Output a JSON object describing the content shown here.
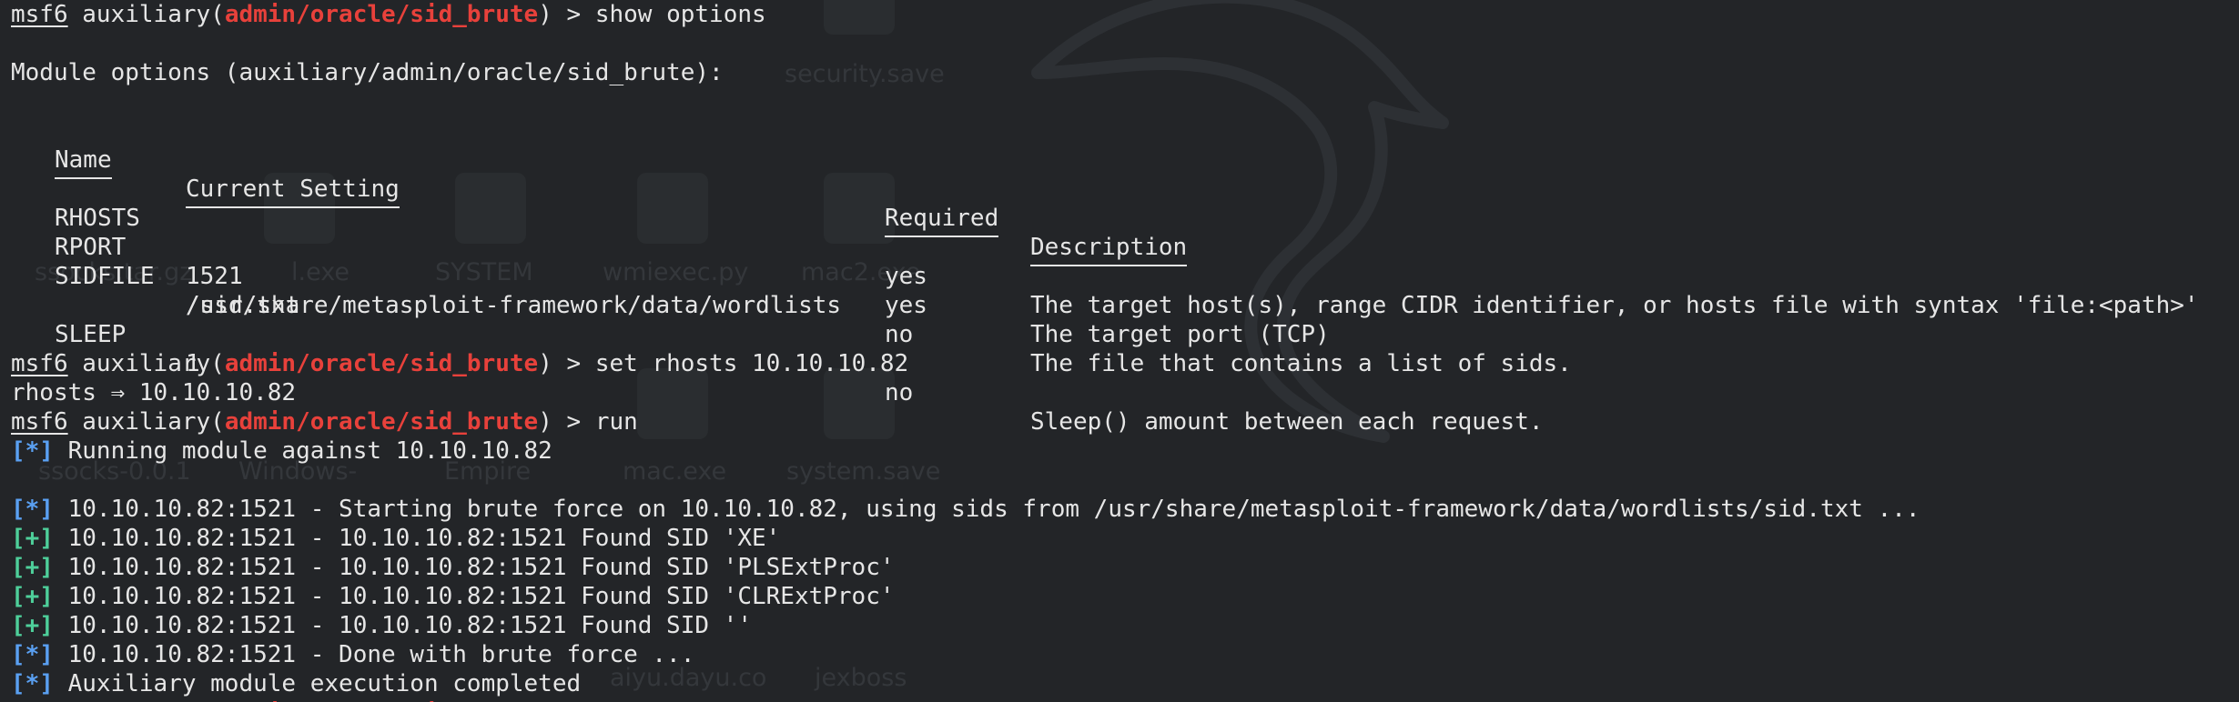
{
  "prompt": {
    "user": "msf6",
    "prefix": " auxiliary(",
    "module": "admin/oracle/sid_brute",
    "suffix": ") > "
  },
  "commands": {
    "show": "show options",
    "set": "set rhosts 10.10.10.82",
    "run": "run"
  },
  "module_options_title": "Module options (auxiliary/admin/oracle/sid_brute):",
  "options_table": {
    "headers": {
      "name": "Name",
      "current_setting": "Current Setting",
      "required": "Required",
      "description": "Description"
    },
    "rows": [
      {
        "name": "RHOSTS",
        "setting": "",
        "setting_cont": "",
        "required": "yes",
        "description": "The target host(s), range CIDR identifier, or hosts file with syntax 'file:<path>'"
      },
      {
        "name": "RPORT",
        "setting": "1521",
        "setting_cont": "",
        "required": "yes",
        "description": "The target port (TCP)"
      },
      {
        "name": "SIDFILE",
        "setting": "/usr/share/metasploit-framework/data/wordlists",
        "setting_cont": "/sid.txt",
        "required": "no",
        "description": "The file that contains a list of sids."
      },
      {
        "name": "SLEEP",
        "setting": "1",
        "setting_cont": "",
        "required": "no",
        "description": "Sleep() amount between each request."
      }
    ]
  },
  "set_result": "rhosts ⇒ 10.10.10.82",
  "output": [
    {
      "tag": "[*]",
      "kind": "info",
      "text": " Running module against 10.10.10.82",
      "gap_after": true
    },
    {
      "tag": "[*]",
      "kind": "info",
      "text": " 10.10.10.82:1521 - Starting brute force on 10.10.10.82, using sids from /usr/share/metasploit-framework/data/wordlists/sid.txt ..."
    },
    {
      "tag": "[+]",
      "kind": "good",
      "text": " 10.10.10.82:1521 - 10.10.10.82:1521 Found SID 'XE'"
    },
    {
      "tag": "[+]",
      "kind": "good",
      "text": " 10.10.10.82:1521 - 10.10.10.82:1521 Found SID 'PLSExtProc'"
    },
    {
      "tag": "[+]",
      "kind": "good",
      "text": " 10.10.10.82:1521 - 10.10.10.82:1521 Found SID 'CLRExtProc'"
    },
    {
      "tag": "[+]",
      "kind": "good",
      "text": " 10.10.10.82:1521 - 10.10.10.82:1521 Found SID ''"
    },
    {
      "tag": "[*]",
      "kind": "info",
      "text": " 10.10.10.82:1521 - Done with brute force ..."
    },
    {
      "tag": "[*]",
      "kind": "info",
      "text": " Auxiliary module execution completed"
    }
  ],
  "desktop_background": {
    "icon_labels": [
      "security.save",
      "ssocks.tar.gz",
      "l.exe",
      "SYSTEM",
      "wmiexec.py",
      "mac2.exe",
      "ssocks-0.0.1",
      "Windows-",
      "Empire",
      "mac.exe",
      "system.save",
      "aiyu.dayu.co",
      "jexboss"
    ]
  },
  "colors": {
    "background": "#232528",
    "text": "#e6e6e6",
    "module_red": "#e8413b",
    "info_blue": "#5aa0f2",
    "success_green": "#4ecf9a"
  }
}
